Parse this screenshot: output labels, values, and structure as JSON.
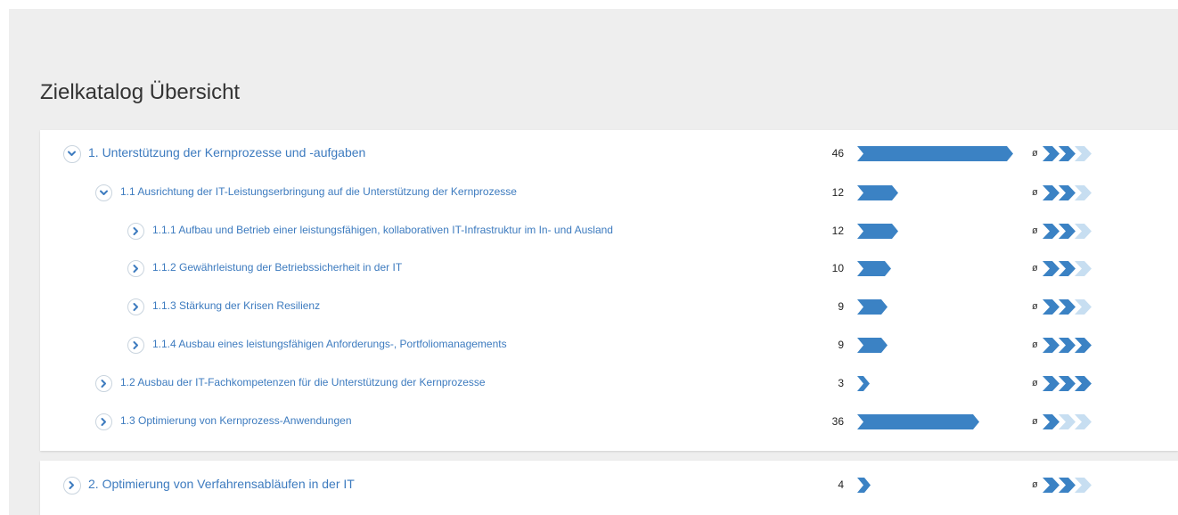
{
  "page": {
    "title": "Zielkatalog Übersicht"
  },
  "colors": {
    "accent": "#3b82c4",
    "accent_light": "#c7def1",
    "link": "#3d7bbf"
  },
  "avg_symbol": "ø",
  "rows": [
    {
      "label": "1. Unterstützung der Kernprozesse und -aufgaben",
      "level": 1,
      "expanded": true,
      "count": "46",
      "bar": 46,
      "rating": 2
    },
    {
      "label": "1.1 Ausrichtung der IT-Leistungserbringung auf die Unterstützung der Kernprozesse",
      "level": 2,
      "expanded": true,
      "count": "12",
      "bar": 12,
      "rating": 2
    },
    {
      "label": "1.1.1 Aufbau und Betrieb einer leistungsfähigen, kollaborativen IT-Infrastruktur im In- und Ausland",
      "level": 3,
      "expanded": false,
      "count": "12",
      "bar": 12,
      "rating": 2
    },
    {
      "label": "1.1.2 Gewährleistung der Betriebssicherheit in der IT",
      "level": 3,
      "expanded": false,
      "count": "10",
      "bar": 10,
      "rating": 2
    },
    {
      "label": "1.1.3 Stärkung der Krisen Resilienz",
      "level": 3,
      "expanded": false,
      "count": "9",
      "bar": 9,
      "rating": 2
    },
    {
      "label": "1.1.4 Ausbau eines leistungsfähigen Anforderungs-, Portfoliomanagements",
      "level": 3,
      "expanded": false,
      "count": "9",
      "bar": 9,
      "rating": 3
    },
    {
      "label": "1.2 Ausbau der IT-Fachkompetenzen für die Unterstützung der Kernprozesse",
      "level": 2,
      "expanded": false,
      "count": "3",
      "bar": 3,
      "rating": 3
    },
    {
      "label": "1.3 Optimierung von Kernprozess-Anwendungen",
      "level": 2,
      "expanded": false,
      "count": "36",
      "bar": 36,
      "rating": 1
    },
    {
      "label": "2. Optimierung von Verfahrensabläufen in der IT",
      "level": 1,
      "expanded": false,
      "count": "4",
      "bar": 4,
      "rating": 2
    }
  ]
}
